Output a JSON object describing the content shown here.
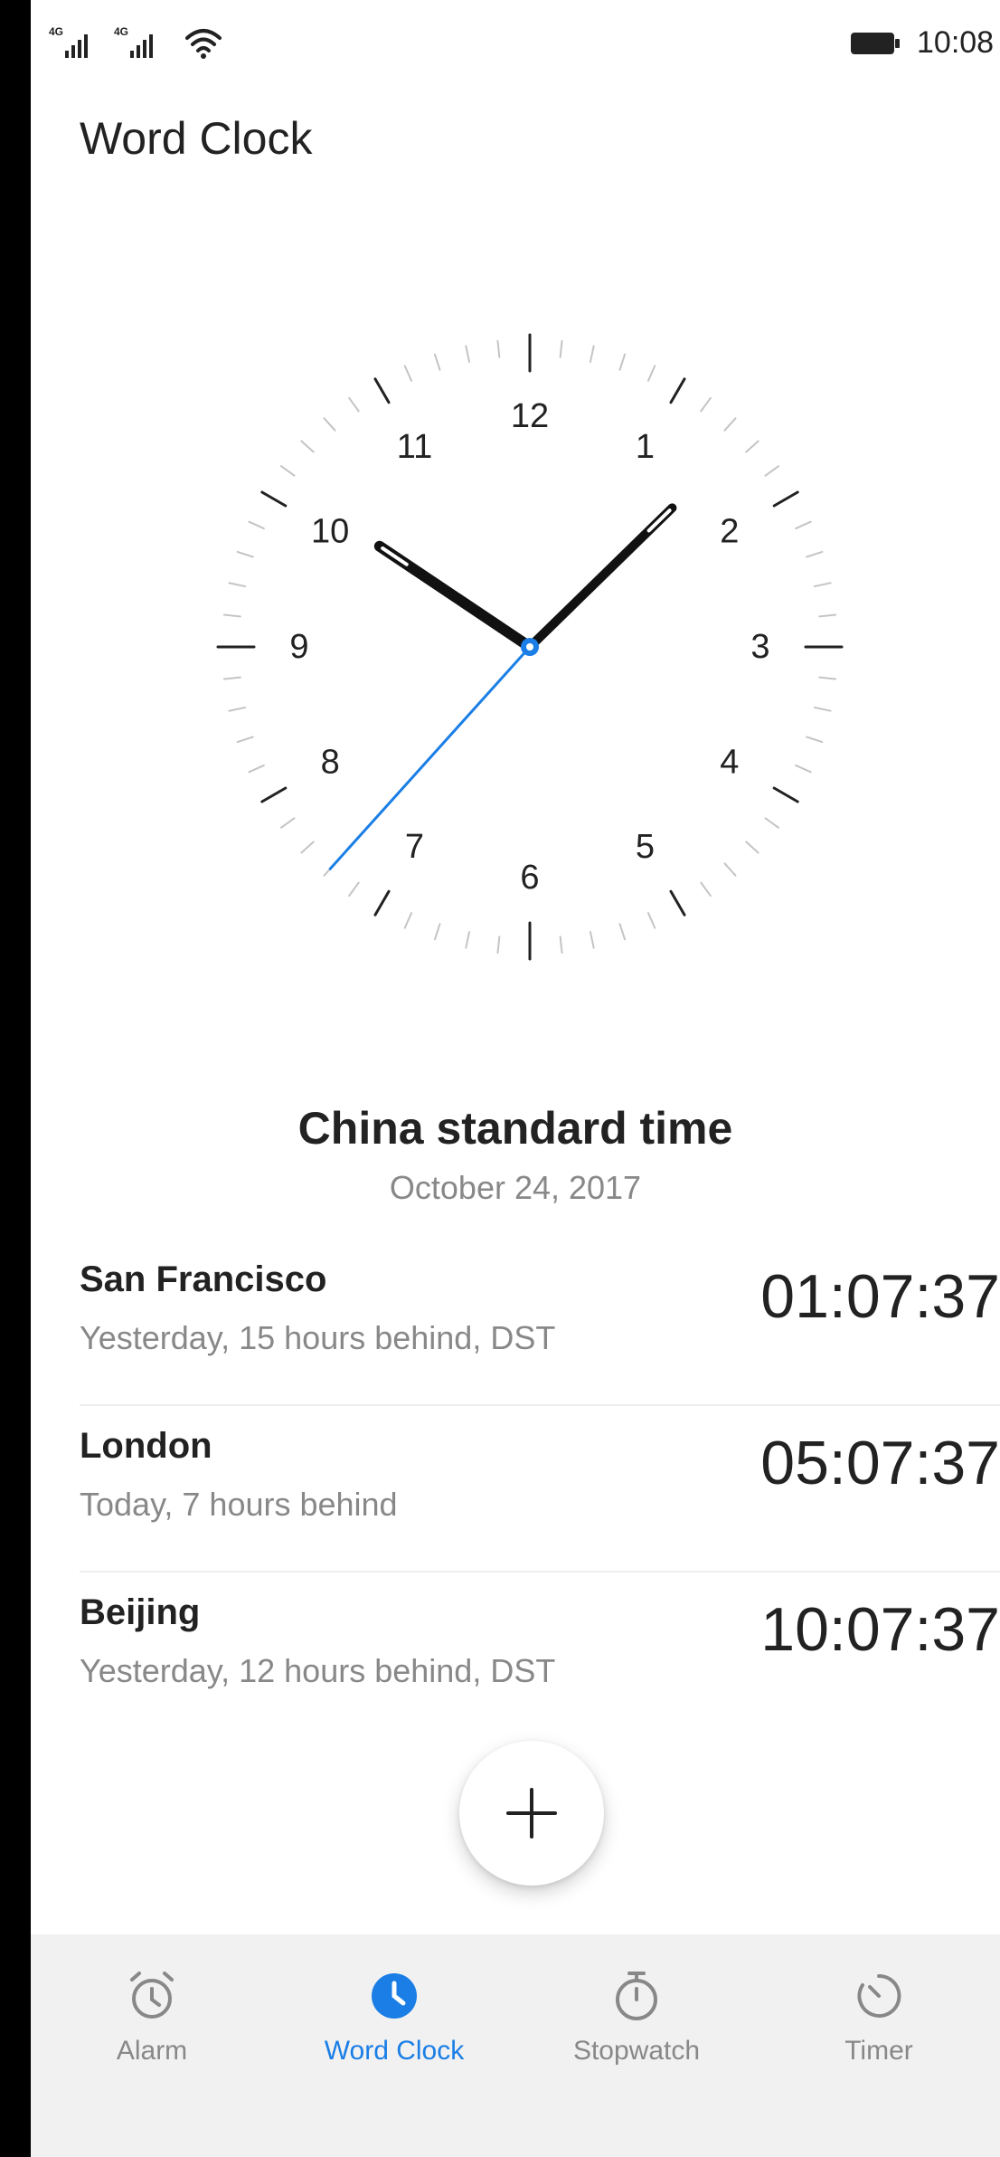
{
  "status_bar": {
    "signal1_label": "4G",
    "signal2_label": "4G",
    "time": "10:08"
  },
  "header": {
    "title": "Word Clock"
  },
  "clock": {
    "numbers": [
      "12",
      "1",
      "2",
      "3",
      "4",
      "5",
      "6",
      "7",
      "8",
      "9",
      "10",
      "11"
    ],
    "hour": 10,
    "minute": 7,
    "second": 37
  },
  "current": {
    "zone": "China standard time",
    "date": "October 24, 2017"
  },
  "cities": [
    {
      "name": "San Francisco",
      "desc": "Yesterday, 15 hours behind, DST",
      "time": "01:07:37"
    },
    {
      "name": "London",
      "desc": "Today, 7 hours behind",
      "time": "05:07:37"
    },
    {
      "name": "Beijing",
      "desc": "Yesterday, 12 hours behind, DST",
      "time": "10:07:37"
    }
  ],
  "fab": {
    "icon": "plus-icon"
  },
  "tabs": [
    {
      "label": "Alarm",
      "icon": "alarm-clock-icon",
      "active": false
    },
    {
      "label": "Word Clock",
      "icon": "clock-icon",
      "active": true
    },
    {
      "label": "Stopwatch",
      "icon": "stopwatch-icon",
      "active": false
    },
    {
      "label": "Timer",
      "icon": "timer-icon",
      "active": false
    }
  ],
  "colors": {
    "accent": "#1a7ee6",
    "text": "#222222",
    "secondary": "#888888"
  }
}
